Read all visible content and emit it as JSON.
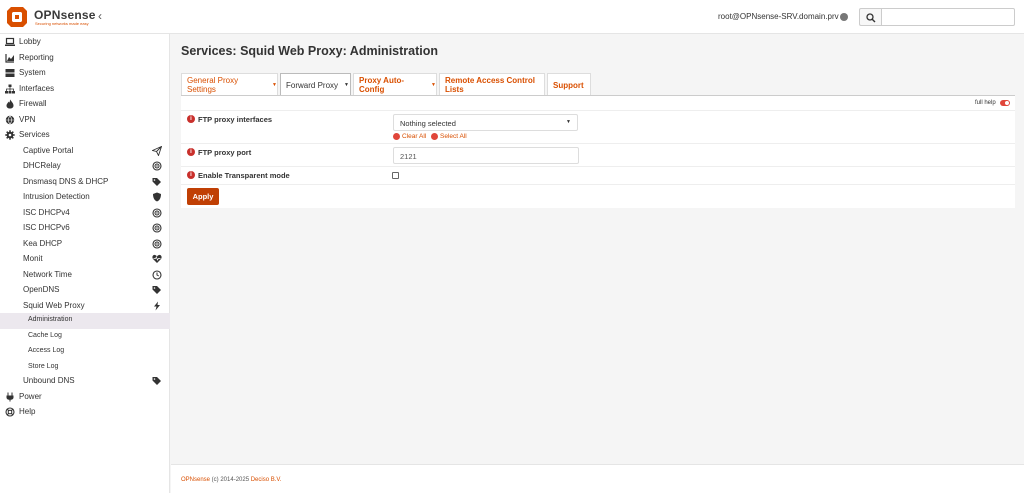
{
  "header": {
    "brand": "OPNsense",
    "tagline": "Securing networks made easy",
    "collapse_glyph": "‹",
    "user": "root@OPNsense-SRV.domain.prv",
    "search_placeholder": ""
  },
  "sidebar": {
    "items": [
      {
        "label": "Lobby",
        "icon": "laptop-icon"
      },
      {
        "label": "Reporting",
        "icon": "chart-icon"
      },
      {
        "label": "System",
        "icon": "server-icon"
      },
      {
        "label": "Interfaces",
        "icon": "sitemap-icon"
      },
      {
        "label": "Firewall",
        "icon": "fire-icon"
      },
      {
        "label": "VPN",
        "icon": "globe-icon"
      },
      {
        "label": "Services",
        "icon": "cog-icon"
      }
    ],
    "services": [
      {
        "label": "Captive Portal",
        "icon": "paper-plane-icon"
      },
      {
        "label": "DHCRelay",
        "icon": "bullseye-icon"
      },
      {
        "label": "Dnsmasq DNS & DHCP",
        "icon": "tags-icon"
      },
      {
        "label": "Intrusion Detection",
        "icon": "shield-icon"
      },
      {
        "label": "ISC DHCPv4",
        "icon": "bullseye-icon"
      },
      {
        "label": "ISC DHCPv6",
        "icon": "bullseye-icon"
      },
      {
        "label": "Kea DHCP",
        "icon": "bullseye-icon"
      },
      {
        "label": "Monit",
        "icon": "heartbeat-icon"
      },
      {
        "label": "Network Time",
        "icon": "clock-icon"
      },
      {
        "label": "OpenDNS",
        "icon": "tags-icon"
      },
      {
        "label": "Squid Web Proxy",
        "icon": "bolt-icon"
      }
    ],
    "squid_sub": [
      {
        "label": "Administration"
      },
      {
        "label": "Cache Log"
      },
      {
        "label": "Access Log"
      },
      {
        "label": "Store Log"
      }
    ],
    "after": [
      {
        "label": "Unbound DNS",
        "icon": "tags-icon"
      },
      {
        "label": "Power",
        "icon": "plug-icon"
      },
      {
        "label": "Help",
        "icon": "life-ring-icon"
      }
    ]
  },
  "main": {
    "title": "Services: Squid Web Proxy: Administration",
    "tabs": [
      {
        "label": "General Proxy Settings",
        "dropdown": true
      },
      {
        "label": "Forward Proxy",
        "dropdown": true
      },
      {
        "label": "Proxy Auto-Config",
        "dropdown": true
      },
      {
        "label": "Remote Access Control Lists",
        "dropdown": false
      },
      {
        "label": "Support",
        "dropdown": false
      }
    ],
    "full_help": "full help",
    "form": {
      "ftp_interfaces_label": "FTP proxy interfaces",
      "ftp_interfaces_value": "Nothing selected",
      "clear_all": "Clear All",
      "select_all": "Select All",
      "ftp_port_label": "FTP proxy port",
      "ftp_port_value": "2121",
      "transparent_label": "Enable Transparent mode",
      "transparent_checked": false
    },
    "apply": "Apply"
  },
  "footer": {
    "brand": "OPNsense",
    "text": " (c) 2014-2025 ",
    "company": "Deciso B.V."
  }
}
